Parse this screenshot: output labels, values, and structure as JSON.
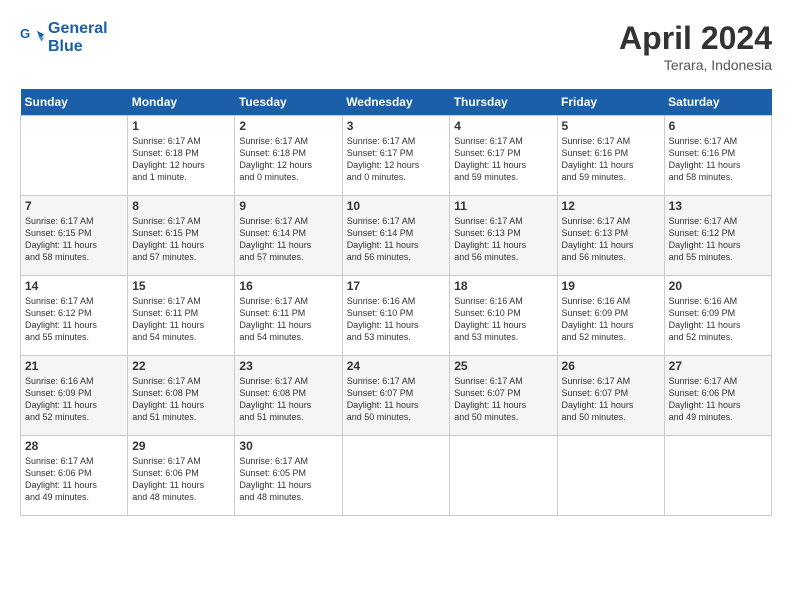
{
  "header": {
    "logo_line1": "General",
    "logo_line2": "Blue",
    "month_title": "April 2024",
    "subtitle": "Terara, Indonesia"
  },
  "days_of_week": [
    "Sunday",
    "Monday",
    "Tuesday",
    "Wednesday",
    "Thursday",
    "Friday",
    "Saturday"
  ],
  "weeks": [
    [
      {
        "day": "",
        "info": ""
      },
      {
        "day": "1",
        "info": "Sunrise: 6:17 AM\nSunset: 6:18 PM\nDaylight: 12 hours\nand 1 minute."
      },
      {
        "day": "2",
        "info": "Sunrise: 6:17 AM\nSunset: 6:18 PM\nDaylight: 12 hours\nand 0 minutes."
      },
      {
        "day": "3",
        "info": "Sunrise: 6:17 AM\nSunset: 6:17 PM\nDaylight: 12 hours\nand 0 minutes."
      },
      {
        "day": "4",
        "info": "Sunrise: 6:17 AM\nSunset: 6:17 PM\nDaylight: 11 hours\nand 59 minutes."
      },
      {
        "day": "5",
        "info": "Sunrise: 6:17 AM\nSunset: 6:16 PM\nDaylight: 11 hours\nand 59 minutes."
      },
      {
        "day": "6",
        "info": "Sunrise: 6:17 AM\nSunset: 6:16 PM\nDaylight: 11 hours\nand 58 minutes."
      }
    ],
    [
      {
        "day": "7",
        "info": "Sunrise: 6:17 AM\nSunset: 6:15 PM\nDaylight: 11 hours\nand 58 minutes."
      },
      {
        "day": "8",
        "info": "Sunrise: 6:17 AM\nSunset: 6:15 PM\nDaylight: 11 hours\nand 57 minutes."
      },
      {
        "day": "9",
        "info": "Sunrise: 6:17 AM\nSunset: 6:14 PM\nDaylight: 11 hours\nand 57 minutes."
      },
      {
        "day": "10",
        "info": "Sunrise: 6:17 AM\nSunset: 6:14 PM\nDaylight: 11 hours\nand 56 minutes."
      },
      {
        "day": "11",
        "info": "Sunrise: 6:17 AM\nSunset: 6:13 PM\nDaylight: 11 hours\nand 56 minutes."
      },
      {
        "day": "12",
        "info": "Sunrise: 6:17 AM\nSunset: 6:13 PM\nDaylight: 11 hours\nand 56 minutes."
      },
      {
        "day": "13",
        "info": "Sunrise: 6:17 AM\nSunset: 6:12 PM\nDaylight: 11 hours\nand 55 minutes."
      }
    ],
    [
      {
        "day": "14",
        "info": "Sunrise: 6:17 AM\nSunset: 6:12 PM\nDaylight: 11 hours\nand 55 minutes."
      },
      {
        "day": "15",
        "info": "Sunrise: 6:17 AM\nSunset: 6:11 PM\nDaylight: 11 hours\nand 54 minutes."
      },
      {
        "day": "16",
        "info": "Sunrise: 6:17 AM\nSunset: 6:11 PM\nDaylight: 11 hours\nand 54 minutes."
      },
      {
        "day": "17",
        "info": "Sunrise: 6:16 AM\nSunset: 6:10 PM\nDaylight: 11 hours\nand 53 minutes."
      },
      {
        "day": "18",
        "info": "Sunrise: 6:16 AM\nSunset: 6:10 PM\nDaylight: 11 hours\nand 53 minutes."
      },
      {
        "day": "19",
        "info": "Sunrise: 6:16 AM\nSunset: 6:09 PM\nDaylight: 11 hours\nand 52 minutes."
      },
      {
        "day": "20",
        "info": "Sunrise: 6:16 AM\nSunset: 6:09 PM\nDaylight: 11 hours\nand 52 minutes."
      }
    ],
    [
      {
        "day": "21",
        "info": "Sunrise: 6:16 AM\nSunset: 6:09 PM\nDaylight: 11 hours\nand 52 minutes."
      },
      {
        "day": "22",
        "info": "Sunrise: 6:17 AM\nSunset: 6:08 PM\nDaylight: 11 hours\nand 51 minutes."
      },
      {
        "day": "23",
        "info": "Sunrise: 6:17 AM\nSunset: 6:08 PM\nDaylight: 11 hours\nand 51 minutes."
      },
      {
        "day": "24",
        "info": "Sunrise: 6:17 AM\nSunset: 6:07 PM\nDaylight: 11 hours\nand 50 minutes."
      },
      {
        "day": "25",
        "info": "Sunrise: 6:17 AM\nSunset: 6:07 PM\nDaylight: 11 hours\nand 50 minutes."
      },
      {
        "day": "26",
        "info": "Sunrise: 6:17 AM\nSunset: 6:07 PM\nDaylight: 11 hours\nand 50 minutes."
      },
      {
        "day": "27",
        "info": "Sunrise: 6:17 AM\nSunset: 6:06 PM\nDaylight: 11 hours\nand 49 minutes."
      }
    ],
    [
      {
        "day": "28",
        "info": "Sunrise: 6:17 AM\nSunset: 6:06 PM\nDaylight: 11 hours\nand 49 minutes."
      },
      {
        "day": "29",
        "info": "Sunrise: 6:17 AM\nSunset: 6:06 PM\nDaylight: 11 hours\nand 48 minutes."
      },
      {
        "day": "30",
        "info": "Sunrise: 6:17 AM\nSunset: 6:05 PM\nDaylight: 11 hours\nand 48 minutes."
      },
      {
        "day": "",
        "info": ""
      },
      {
        "day": "",
        "info": ""
      },
      {
        "day": "",
        "info": ""
      },
      {
        "day": "",
        "info": ""
      }
    ]
  ]
}
